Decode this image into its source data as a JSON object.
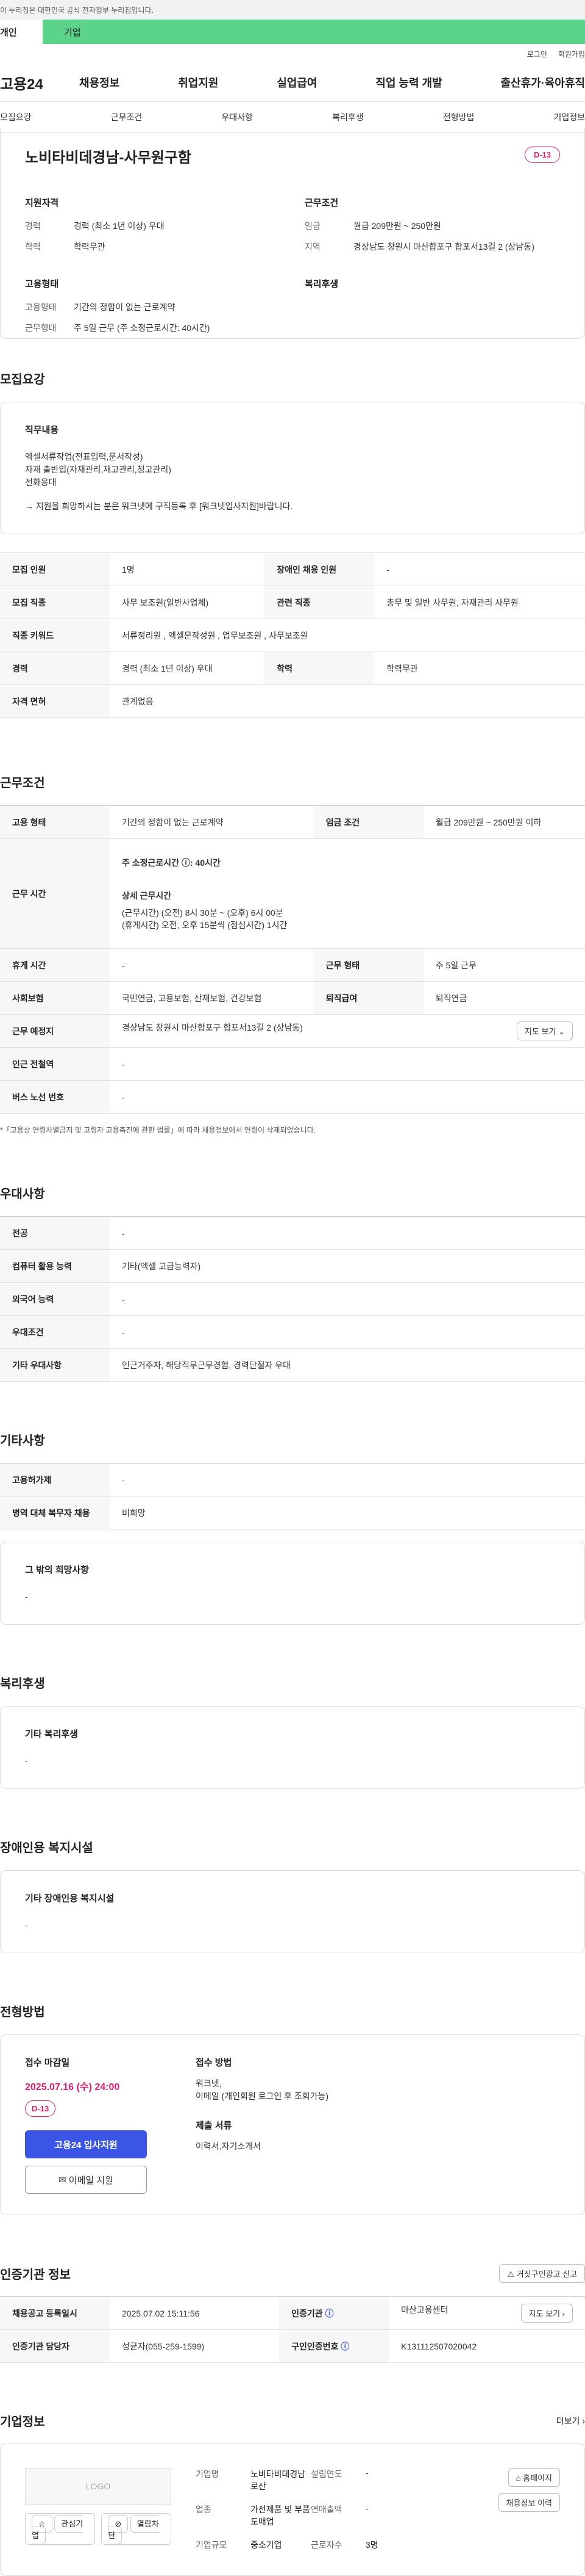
{
  "gov_notice": "이 누리집은 대한민국 공식 전자정부 누리집입니다.",
  "sub_bar": {
    "left": "개인",
    "right": "기업"
  },
  "login": {
    "login": "로그인",
    "join": "회원가입"
  },
  "logo": "고용24",
  "gnb": [
    "채용정보",
    "취업지원",
    "실업급여",
    "직업 능력 개발",
    "출산휴가·육아휴직"
  ],
  "tabs": [
    "모집요강",
    "근무조건",
    "우대사항",
    "복리후생",
    "전형방법",
    "기업정보"
  ],
  "summary": {
    "title": "노비타비데경남-사무원구함",
    "dday": "D-13",
    "qual_title": "지원자격",
    "qual": [
      {
        "k": "경력",
        "v": "경력 (최소 1년 이상) 우대"
      },
      {
        "k": "학력",
        "v": "학력무관"
      }
    ],
    "cond_title": "근무조건",
    "cond": [
      {
        "k": "임금",
        "v": "월급 209만원 ~ 250만원"
      },
      {
        "k": "지역",
        "v": "경상남도 창원시 마산합포구 합포서13길 2 (상남동)"
      }
    ],
    "emp_title": "고용형태",
    "emp": [
      {
        "k": "고용형태",
        "v": "기간의 정함이 없는 근로계약"
      },
      {
        "k": "근무형태",
        "v": "주 5일 근무 (주 소정근로시간: 40시간)"
      }
    ],
    "welfare_title": "복리후생"
  },
  "recruit": {
    "title": "모집요강",
    "job_head": "직무내용",
    "job_lines": [
      "엑셀서류작업(전표입력,문서작성) ",
      "자재 출반입(자재관리,재고관리,청고관리)",
      "전화응대"
    ],
    "job_note": "→ 지원을 희망하시는 분은 워크넷에 구직등록 후 [워크넷입사지원]바랍니다.",
    "rows": [
      [
        "모집 인원",
        "1명",
        "장애인 채용 인원",
        "-"
      ],
      [
        "모집 직종",
        "사무 보조원(일반사업체)",
        "관련 직종",
        "총무 및 일반 사무원, 자재관리 사무원"
      ],
      [
        "직종 키워드",
        "서류정리원 , 엑셀문작성원 , 업무보조원 , 사무보조원",
        "",
        ""
      ],
      [
        "경력",
        "경력 (최소 1년 이상) 우대",
        "학력",
        "학력무관"
      ],
      [
        "자격 면허",
        "관계없음",
        "",
        ""
      ]
    ]
  },
  "work": {
    "title": "근무조건",
    "emp_type_k": "고용 형태",
    "emp_type_v": "기간의 정함이 없는 근로계약",
    "wage_k": "임금 조건",
    "wage_v": "월급 209만원 ~ 250만원 이하",
    "hours_k": "근무 시간",
    "hours_bold": "주 소정근로시간 ⓘ: 40시간",
    "hours_detail_head": "상세 근무시간",
    "hours_detail": [
      "(근무시간) (오전) 8시 30분 ~ (오후) 6시 00분",
      "(휴게시간) 오전, 오후 15분씩 (점심시간) 1시간"
    ],
    "rest_k": "휴게 시간",
    "rest_v": "-",
    "type_k": "근무 형태",
    "type_v": "주 5일 근무",
    "ins_k": "사회보험",
    "ins_v": "국민연금, 고용보험, 산재보험, 건강보험",
    "ret_k": "퇴직급여",
    "ret_v": "퇴직연금",
    "place_k": "근무 예정지",
    "place_v": "경상남도 창원시 마산합포구 합포서13길 2 (상남동)",
    "map_btn": "지도 보기",
    "station_k": "인근 전철역",
    "station_v": "-",
    "bus_k": "버스 노선 번호",
    "bus_v": "-",
    "note": "*「고용상 연령차별금지 및 고령자 고용촉진에 관한 법률」에 따라 채용정보에서 연령이 삭제되었습니다."
  },
  "pref": {
    "title": "우대사항",
    "rows": [
      [
        "전공",
        "-"
      ],
      [
        "컴퓨터 활용 능력",
        "기타(엑셀 고급능력자)"
      ],
      [
        "외국어 능력",
        "-"
      ],
      [
        "우대조건",
        "-"
      ],
      [
        "기타 우대사항",
        "인근거주자, 해당직무근무경험, 경력단절자 우대"
      ]
    ]
  },
  "etc": {
    "title": "기타사항",
    "rows": [
      [
        "고용허가제",
        "-"
      ],
      [
        "병역 대체 복무자 채용",
        "비희망"
      ]
    ],
    "wish_head": "그 밖의 희망사항",
    "wish_v": "-"
  },
  "welfare": {
    "title": "복리후생",
    "head": "기타 복리후생",
    "v": "-"
  },
  "disabled": {
    "title": "장애인용 복지시설",
    "head": "기타 장애인용 복지시설",
    "v": "-"
  },
  "apply": {
    "title": "전형방법",
    "deadline_head": "접수 마감일",
    "deadline": "2025.07.16 (수) 24:00",
    "dday": "D-13",
    "apply_btn": "고용24 입사지원",
    "email_btn": "이메일 지원",
    "method_head": "접수 방법",
    "method": [
      "워크넷,",
      "이메일 (개인회원 로그인 후 조회가능)"
    ],
    "docs_head": "제출 서류",
    "docs": "이력서,자기소개서"
  },
  "cert": {
    "title": "인증기관 정보",
    "report_btn": "거짓구인광고 신고",
    "rows": [
      [
        "채용공고 등록일시",
        "2025.07.02 15:11:56",
        "인증기관",
        "마산고용센터"
      ],
      [
        "인증기관 담당자",
        "성균자(055-259-1599)",
        "구인인증번호",
        "K131112507020042"
      ]
    ],
    "map_btn": "지도 보기"
  },
  "company": {
    "title": "기업정보",
    "more": "더보기",
    "logo": "LOGO",
    "fav": "관심기업",
    "block": "열람차단",
    "rows": [
      [
        "기업명",
        "노비타비데경남로산",
        "설립연도",
        "-"
      ],
      [
        "업종",
        "가전제품 및 부품 도매업",
        "연매출액",
        "-"
      ],
      [
        "기업규모",
        "중소기업",
        "근로자수",
        "3명"
      ]
    ],
    "homepage": "홈페이지",
    "history": "채용정보 이력"
  }
}
